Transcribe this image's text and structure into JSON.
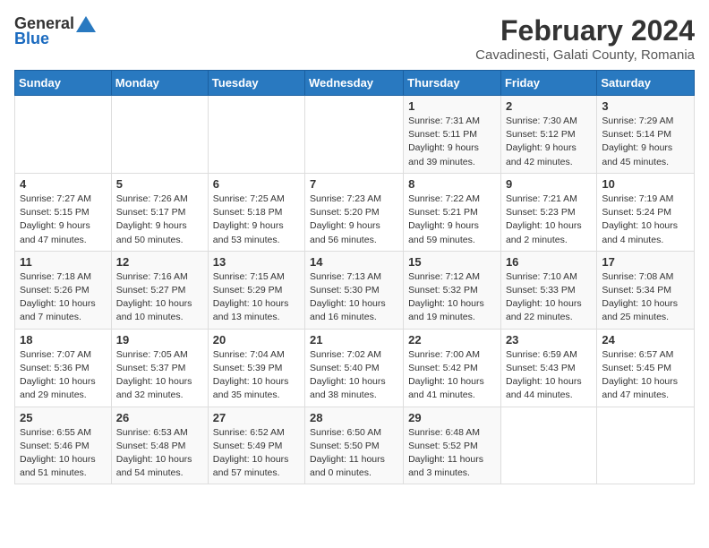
{
  "logo": {
    "general": "General",
    "blue": "Blue"
  },
  "title": "February 2024",
  "subtitle": "Cavadinesti, Galati County, Romania",
  "days_header": [
    "Sunday",
    "Monday",
    "Tuesday",
    "Wednesday",
    "Thursday",
    "Friday",
    "Saturday"
  ],
  "weeks": [
    [
      {
        "day": "",
        "info": ""
      },
      {
        "day": "",
        "info": ""
      },
      {
        "day": "",
        "info": ""
      },
      {
        "day": "",
        "info": ""
      },
      {
        "day": "1",
        "info": "Sunrise: 7:31 AM\nSunset: 5:11 PM\nDaylight: 9 hours\nand 39 minutes."
      },
      {
        "day": "2",
        "info": "Sunrise: 7:30 AM\nSunset: 5:12 PM\nDaylight: 9 hours\nand 42 minutes."
      },
      {
        "day": "3",
        "info": "Sunrise: 7:29 AM\nSunset: 5:14 PM\nDaylight: 9 hours\nand 45 minutes."
      }
    ],
    [
      {
        "day": "4",
        "info": "Sunrise: 7:27 AM\nSunset: 5:15 PM\nDaylight: 9 hours\nand 47 minutes."
      },
      {
        "day": "5",
        "info": "Sunrise: 7:26 AM\nSunset: 5:17 PM\nDaylight: 9 hours\nand 50 minutes."
      },
      {
        "day": "6",
        "info": "Sunrise: 7:25 AM\nSunset: 5:18 PM\nDaylight: 9 hours\nand 53 minutes."
      },
      {
        "day": "7",
        "info": "Sunrise: 7:23 AM\nSunset: 5:20 PM\nDaylight: 9 hours\nand 56 minutes."
      },
      {
        "day": "8",
        "info": "Sunrise: 7:22 AM\nSunset: 5:21 PM\nDaylight: 9 hours\nand 59 minutes."
      },
      {
        "day": "9",
        "info": "Sunrise: 7:21 AM\nSunset: 5:23 PM\nDaylight: 10 hours\nand 2 minutes."
      },
      {
        "day": "10",
        "info": "Sunrise: 7:19 AM\nSunset: 5:24 PM\nDaylight: 10 hours\nand 4 minutes."
      }
    ],
    [
      {
        "day": "11",
        "info": "Sunrise: 7:18 AM\nSunset: 5:26 PM\nDaylight: 10 hours\nand 7 minutes."
      },
      {
        "day": "12",
        "info": "Sunrise: 7:16 AM\nSunset: 5:27 PM\nDaylight: 10 hours\nand 10 minutes."
      },
      {
        "day": "13",
        "info": "Sunrise: 7:15 AM\nSunset: 5:29 PM\nDaylight: 10 hours\nand 13 minutes."
      },
      {
        "day": "14",
        "info": "Sunrise: 7:13 AM\nSunset: 5:30 PM\nDaylight: 10 hours\nand 16 minutes."
      },
      {
        "day": "15",
        "info": "Sunrise: 7:12 AM\nSunset: 5:32 PM\nDaylight: 10 hours\nand 19 minutes."
      },
      {
        "day": "16",
        "info": "Sunrise: 7:10 AM\nSunset: 5:33 PM\nDaylight: 10 hours\nand 22 minutes."
      },
      {
        "day": "17",
        "info": "Sunrise: 7:08 AM\nSunset: 5:34 PM\nDaylight: 10 hours\nand 25 minutes."
      }
    ],
    [
      {
        "day": "18",
        "info": "Sunrise: 7:07 AM\nSunset: 5:36 PM\nDaylight: 10 hours\nand 29 minutes."
      },
      {
        "day": "19",
        "info": "Sunrise: 7:05 AM\nSunset: 5:37 PM\nDaylight: 10 hours\nand 32 minutes."
      },
      {
        "day": "20",
        "info": "Sunrise: 7:04 AM\nSunset: 5:39 PM\nDaylight: 10 hours\nand 35 minutes."
      },
      {
        "day": "21",
        "info": "Sunrise: 7:02 AM\nSunset: 5:40 PM\nDaylight: 10 hours\nand 38 minutes."
      },
      {
        "day": "22",
        "info": "Sunrise: 7:00 AM\nSunset: 5:42 PM\nDaylight: 10 hours\nand 41 minutes."
      },
      {
        "day": "23",
        "info": "Sunrise: 6:59 AM\nSunset: 5:43 PM\nDaylight: 10 hours\nand 44 minutes."
      },
      {
        "day": "24",
        "info": "Sunrise: 6:57 AM\nSunset: 5:45 PM\nDaylight: 10 hours\nand 47 minutes."
      }
    ],
    [
      {
        "day": "25",
        "info": "Sunrise: 6:55 AM\nSunset: 5:46 PM\nDaylight: 10 hours\nand 51 minutes."
      },
      {
        "day": "26",
        "info": "Sunrise: 6:53 AM\nSunset: 5:48 PM\nDaylight: 10 hours\nand 54 minutes."
      },
      {
        "day": "27",
        "info": "Sunrise: 6:52 AM\nSunset: 5:49 PM\nDaylight: 10 hours\nand 57 minutes."
      },
      {
        "day": "28",
        "info": "Sunrise: 6:50 AM\nSunset: 5:50 PM\nDaylight: 11 hours\nand 0 minutes."
      },
      {
        "day": "29",
        "info": "Sunrise: 6:48 AM\nSunset: 5:52 PM\nDaylight: 11 hours\nand 3 minutes."
      },
      {
        "day": "",
        "info": ""
      },
      {
        "day": "",
        "info": ""
      }
    ]
  ]
}
